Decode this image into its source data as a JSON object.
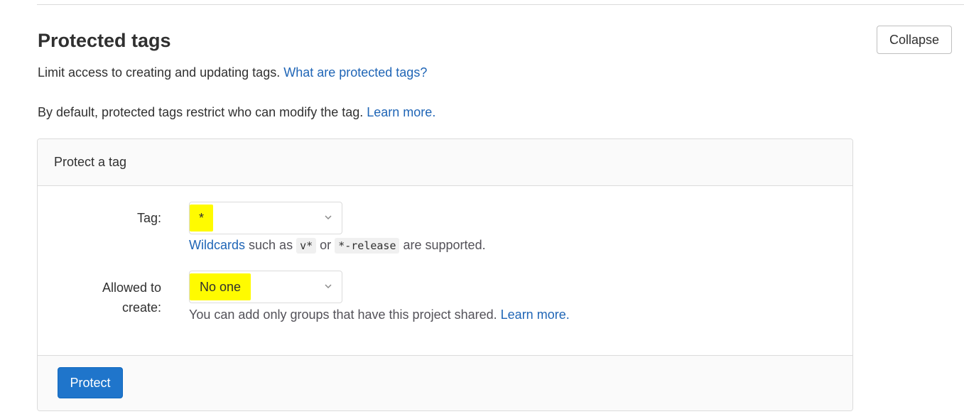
{
  "section": {
    "title": "Protected tags",
    "collapse_label": "Collapse",
    "intro_text": "Limit access to creating and updating tags.",
    "intro_link": "What are protected tags?",
    "default_text": "By default, protected tags restrict who can modify the tag.",
    "default_link": "Learn more."
  },
  "form": {
    "header": "Protect a tag",
    "tag_label": "Tag:",
    "tag_value": "*",
    "wildcards_link": "Wildcards",
    "wildcards_text_1": "such as",
    "wildcard_example_1": "v*",
    "wildcards_text_2": "or",
    "wildcard_example_2": "*-release",
    "wildcards_text_3": "are supported.",
    "allowed_label_line1": "Allowed to",
    "allowed_label_line2": "create:",
    "allowed_value": "No one",
    "allowed_help": "You can add only groups that have this project shared.",
    "allowed_help_link": "Learn more.",
    "submit_label": "Protect"
  },
  "icons": {
    "dropdown": "chevron-down-icon"
  },
  "colors": {
    "link": "#1f65b6",
    "primary_button": "#1f75cb",
    "highlight": "#fffb00"
  }
}
